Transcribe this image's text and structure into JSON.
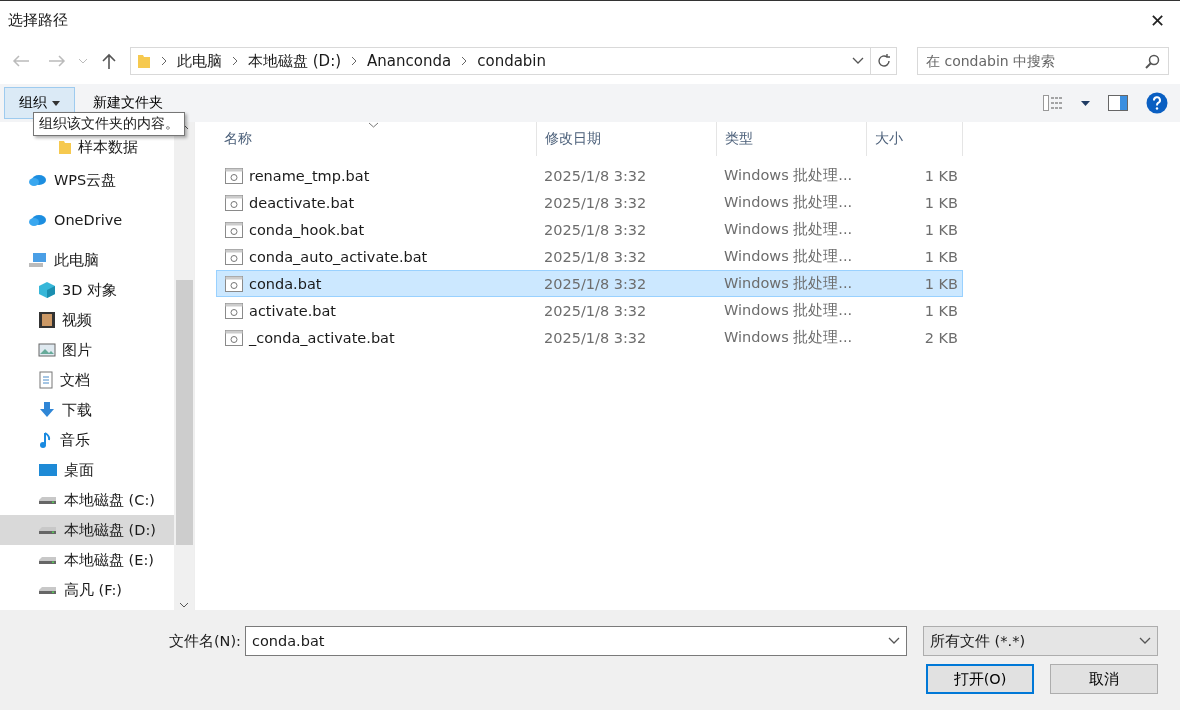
{
  "window": {
    "title": "选择路径",
    "close": "✕"
  },
  "breadcrumb": [
    "此电脑",
    "本地磁盘 (D:)",
    "Ananconda",
    "condabin"
  ],
  "search": {
    "placeholder": "在 condabin 中搜索"
  },
  "toolbar": {
    "organize": "组织",
    "new_folder": "新建文件夹",
    "tooltip": "组织该文件夹的内容。"
  },
  "sidebar": {
    "clipped_children": [
      {
        "label": "样本数据",
        "kind": "folder",
        "selected": false
      }
    ],
    "items": [
      {
        "label": "WPS云盘",
        "kind": "cloud",
        "selected": false
      },
      {
        "label": "OneDrive",
        "kind": "cloud",
        "selected": false
      },
      {
        "label": "此电脑",
        "kind": "pc",
        "selected": false,
        "children": [
          {
            "label": "3D 对象",
            "kind": "cube",
            "selected": false
          },
          {
            "label": "视频",
            "kind": "film",
            "selected": false
          },
          {
            "label": "图片",
            "kind": "image",
            "selected": false
          },
          {
            "label": "文档",
            "kind": "doc",
            "selected": false
          },
          {
            "label": "下载",
            "kind": "download",
            "selected": false
          },
          {
            "label": "音乐",
            "kind": "music",
            "selected": false
          },
          {
            "label": "桌面",
            "kind": "desktop",
            "selected": false
          },
          {
            "label": "本地磁盘 (C:)",
            "kind": "drive",
            "selected": false
          },
          {
            "label": "本地磁盘 (D:)",
            "kind": "drive",
            "selected": true
          },
          {
            "label": "本地磁盘 (E:)",
            "kind": "drive",
            "selected": false
          },
          {
            "label": "高凡 (F:)",
            "kind": "drive",
            "selected": false
          }
        ]
      }
    ]
  },
  "table": {
    "columns": [
      "名称",
      "修改日期",
      "类型",
      "大小"
    ],
    "rows": [
      {
        "name": "rename_tmp.bat",
        "date": "2025/1/8 3:32",
        "type": "Windows 批处理...",
        "size": "1 KB",
        "selected": false
      },
      {
        "name": "deactivate.bat",
        "date": "2025/1/8 3:32",
        "type": "Windows 批处理...",
        "size": "1 KB",
        "selected": false
      },
      {
        "name": "conda_hook.bat",
        "date": "2025/1/8 3:32",
        "type": "Windows 批处理...",
        "size": "1 KB",
        "selected": false
      },
      {
        "name": "conda_auto_activate.bat",
        "date": "2025/1/8 3:32",
        "type": "Windows 批处理...",
        "size": "1 KB",
        "selected": false
      },
      {
        "name": "conda.bat",
        "date": "2025/1/8 3:32",
        "type": "Windows 批处理...",
        "size": "1 KB",
        "selected": true
      },
      {
        "name": "activate.bat",
        "date": "2025/1/8 3:32",
        "type": "Windows 批处理...",
        "size": "1 KB",
        "selected": false
      },
      {
        "name": "_conda_activate.bat",
        "date": "2025/1/8 3:32",
        "type": "Windows 批处理...",
        "size": "2 KB",
        "selected": false
      }
    ]
  },
  "footer": {
    "filename_label": "文件名(N):",
    "filename": "conda.bat",
    "filter": "所有文件 (*.*)",
    "open": "打开(O)",
    "cancel": "取消"
  }
}
